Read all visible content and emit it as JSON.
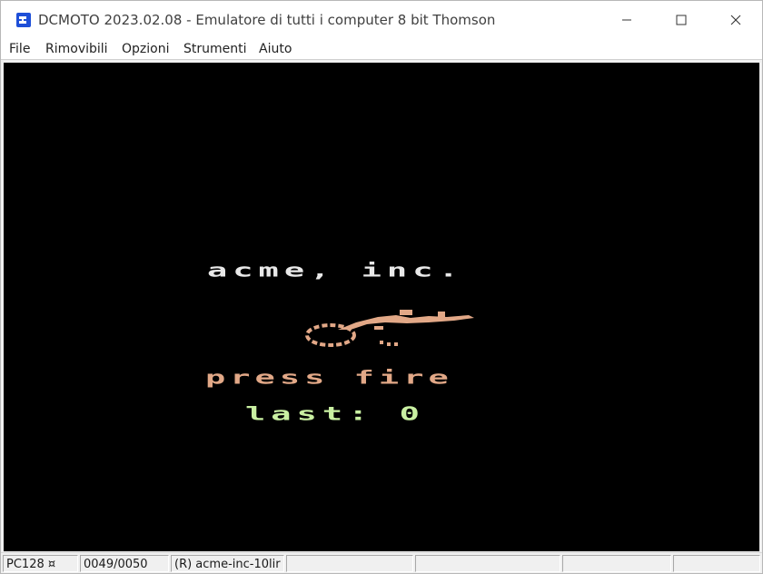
{
  "window": {
    "title": "DCMOTO 2023.02.08 - Emulatore di tutti i computer 8 bit Thomson",
    "icon": "dcmoto-app-icon",
    "controls": {
      "minimize_icon": "minimize-icon",
      "maximize_icon": "maximize-icon",
      "close_icon": "close-icon"
    }
  },
  "menu": {
    "items": [
      "File",
      "Rimovibili",
      "Opzioni",
      "Strumenti",
      "Aiuto"
    ]
  },
  "screen": {
    "title": "acme, inc.",
    "prompt": "press fire",
    "last_label": "last:",
    "last_value": "0",
    "colors": {
      "background": "#000000",
      "title": "#e8e8e8",
      "prompt": "#e2a887",
      "last": "#c9f0a2",
      "sprite": "#e2a887"
    }
  },
  "statusbar": {
    "cells": [
      "PC128 ¤",
      "0049/0050",
      "(R) acme-inc-10lir",
      "",
      "",
      "",
      ""
    ]
  }
}
